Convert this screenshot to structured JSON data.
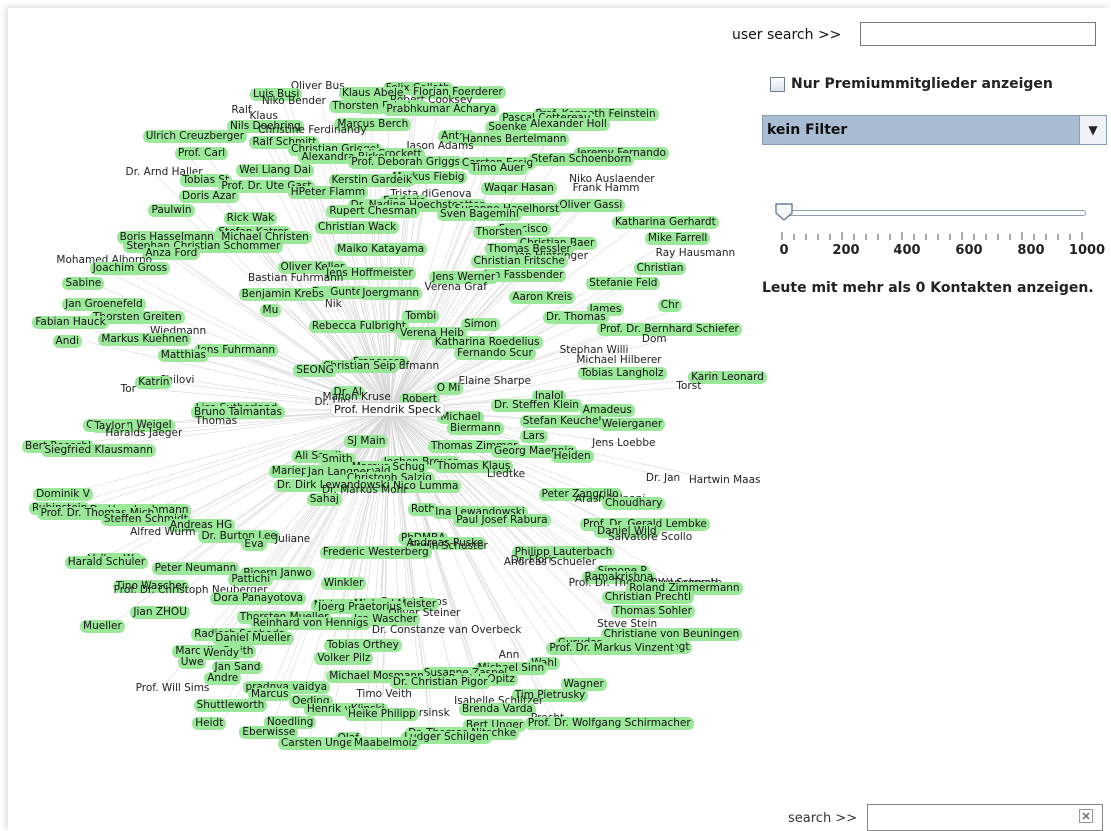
{
  "controls": {
    "user_search_label": "user search >>",
    "user_search_value": "",
    "premium_label": "Nur Premiummitglieder anzeigen",
    "premium_checked": false,
    "filter_value": "kein Filter",
    "slider_value": 0,
    "slider_ticks": [
      "0",
      "200",
      "400",
      "600",
      "800",
      "1000"
    ],
    "contacts_label": "Leute mit mehr als 0 Kontakten anzeigen.",
    "search_label": "search >>",
    "search_value": ""
  },
  "colors": {
    "node_green": "#9be89b",
    "edge": "#d8d8d8",
    "filter_bg": "#a9bcd2"
  },
  "graph": {
    "center": "Prof. Hendrik Speck",
    "nodes": [
      "Oliver Bus",
      "Felix Collath",
      "Klaus Abele",
      "Florian Foerderer",
      "Luis Busi",
      "Robert Cooksey",
      "Niko Bender",
      "Shukri",
      "Thorsten Feiertag",
      "Prabhkumar Acharya",
      "Ralf",
      "Prof. Kenneth Feinstein",
      "Klaus",
      "Pascal Cottereau",
      "Marcus Berch",
      "Alexander Holl",
      "Nils Doehring",
      "Soenke",
      "Christine Ferdinandy",
      "Anton",
      "Ulrich Creuzberger",
      "Hannes Bertelmann",
      "Ralf Schmitt",
      "Jason Adams",
      "Christian Griegel",
      "Jeremy Fernando",
      "Prof. Carl",
      "Juli Crockett",
      "Alexandra Birkel",
      "Stefan Schoenborn",
      "Prof. Deborah Griggs",
      "Carsten Essig",
      "Wei Liang Dai",
      "Timo Auer",
      "Dr. Arnd Haller",
      "Markus Fiebig",
      "Tobias St",
      "Niko Auslaender",
      "Kerstin Gardeik",
      "Frank Hamm",
      "Prof. Dr. Ute Gast",
      "Waqar Hasan",
      "HPeter Flamm",
      "Trista diGenova",
      "Doris Azar",
      "Frederic",
      "Dr. Nadine Hoechstoetter",
      "Oliver Gassi",
      "Paulwin",
      "Susanne Haselhorst",
      "Rupert Chesman",
      "Sven Bagemihl",
      "Rick Wak",
      "Katharina Gerhardt",
      "Christian Wack",
      "Francisco",
      "Stefan Katrer",
      "Thorsten",
      "Boris Hasselmann",
      "Mike Farrell",
      "Michael Christen",
      "Christian Baer",
      "Stephan Christian Schommer",
      "Thomas Bessler",
      "Maiko Katayama",
      "Ray Hausmann",
      "Anza Ford",
      "Jan Hintringer",
      "Mohamed Alborno",
      "Christian Fritsche",
      "Oliver Keller",
      "Christian",
      "Joachim Gross",
      "Jon Fassbender",
      "Jens Hoffmeister",
      "Jens Werner",
      "Bastian Fuhrmann",
      "Stefanie Feld",
      "Sabine",
      "Verena Graf",
      "Dr. Gunter",
      "Joergmann",
      "Benjamin Krebs",
      "Aaron Kreis",
      "Jan Groenefeld",
      "Chr",
      "Nik",
      "James",
      "Mu",
      "Tombi",
      "Thorsten Greiten",
      "Dr. Thomas",
      "Fabian Hauck",
      "Simon",
      "Rebecca Fulbright",
      "Prof. Dr. Bernhard Schiefer",
      "Wiedmann",
      "Verena Heib",
      "Markus Kuehnen",
      "Dom",
      "Andi",
      "Katharina Roedelius",
      "Yvonne",
      "Stephan Willi",
      "Jens Fuhrmann",
      "Fernando Scur",
      "Matthias",
      "Michael Hilberer",
      "Francesca",
      "Jonas Kaufmann",
      "Christian Seip",
      "Tobias Langholz",
      "SEONG",
      "Karin Leonard",
      "Chilovi",
      "Elaine Sharpe",
      "Katrin",
      "Torst",
      "Tor",
      "O Mi",
      "Dr. Al",
      "InaJol",
      "Manon Kruse",
      "Robert",
      "Dr. Ulri",
      "Dr. Steffen Klein",
      "Lisa Sutherland",
      "Amadeus",
      "Bruno Talmantas",
      "Michael",
      "Thomas",
      "Stefan Keuchel",
      "Christian Weigel",
      "Weierganer",
      "Taylor",
      "Biermann",
      "Haralds Jaeger",
      "Lars",
      "SJ Main",
      "Jens Loebbe",
      "Bert Roeschl",
      "Thomas Zimmer",
      "Siegfried Klausmann",
      "Georg Maennig",
      "Ali Samii",
      "Heiden",
      "Smith",
      "Jochen Breuer",
      "Marcus Schug",
      "Thomas Klaus",
      "Mariepaule Macdonald",
      "Liedtke",
      "Jan Langner",
      "Dr. Jan",
      "Christoph Salzig",
      "Hartwin Maas",
      "Dr. Dirk Lewandowski",
      "Nico Lumma",
      "Dr. Markus Mohr",
      "Peter Zangrillo",
      "Dominik V",
      "Arash Yalpani",
      "Sahaj",
      "Choudhary",
      "Rubinstein",
      "Roth",
      "Dr. Uwe Lochmann",
      "Ina Lewandowski",
      "Prof. Dr. Thomas Mich",
      "Paul Josef Rabura",
      "Steffen Schmidt",
      "Prof. Dr. Gerald Lembke",
      "Andreas HG",
      "Daniel Wild",
      "Alfred Wurm",
      "Salvatore Scollo",
      "Dr. Burton Lee",
      "PhDMBA",
      "Juliane",
      "Andreas Puske",
      "Eva",
      "Erwin Schuster",
      "Frederic Westerberg",
      "Philipp Lauterbach",
      "Volker Wa",
      "Dr. Flori",
      "Harald Schuler",
      "Andreas Schueler",
      "Peter Neumann",
      "Simone P",
      "Bjoern Janwo",
      "Ramakrishna",
      "Pattichi",
      "Prof. Dr. Thomas Wengenroth",
      "Winkler",
      "Paul Schwab",
      "Tino Wascher",
      "Roland Zimmermann",
      "Prof. Dr. Christoph Neuberger",
      "Christian Prechtl",
      "Dora Panayotova",
      "Daniel Steps",
      "Nishant",
      "Michael Meister",
      "Joerg Praetorius",
      "Thomas Sohler",
      "Jian ZHOU",
      "Oliver Steiner",
      "Thorsten Mueller",
      "Isa Wascher",
      "Reinhard von Hennigs",
      "Steve Stein",
      "Mueller",
      "Dr. Constanze van Overbeck",
      "Radjesh Soebeda",
      "Christiane von Beuningen",
      "Daniel Mueller",
      "Gurudas",
      "Tobias Orthey",
      "Ayman van Bregt",
      "Marcelle Smith",
      "Prof. Dr. Markus Vinzent",
      "Wendy",
      "Ann",
      "Volker Pilz",
      "Wahl",
      "Uwe",
      "Michael Sinn",
      "Jan Sand",
      "Susanne Zaspel",
      "Michael Mosmann",
      "Patrick Opitz",
      "Andre",
      "Dr. Christian Pigor",
      "pradnya vaidya",
      "Wagner",
      "Prof. Will Sims",
      "Timo Veith",
      "Marcus",
      "Tim Pietrusky",
      "Oeding",
      "Isabelle Schlitzer",
      "Shuttleworth",
      "Brenda Varda",
      "Henrik vKlinski",
      "Wersinsk",
      "Heike Philipp",
      "Precht",
      "Noedling",
      "Prof. Dr. Wolfgang Schirmacher",
      "Heidt",
      "Bert Unger",
      "Eberwisse",
      "Dr. Thomas Nitschke",
      "Olaf",
      "Ludger Schilgen",
      "Carsten Unger",
      "Maabelmoiz"
    ]
  }
}
